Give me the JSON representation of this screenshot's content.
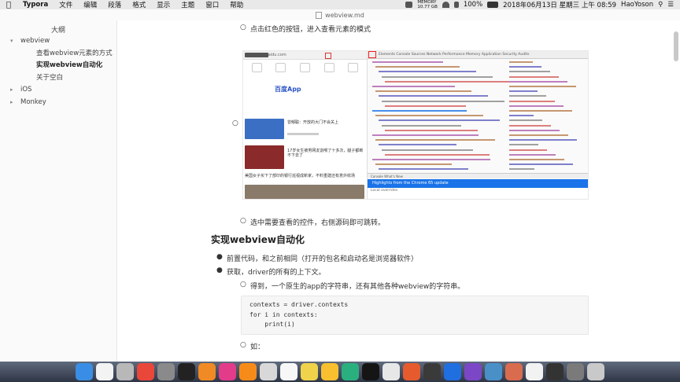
{
  "menubar": {
    "app": "Typora",
    "items": [
      "文件",
      "编辑",
      "段落",
      "格式",
      "显示",
      "主题",
      "窗口",
      "帮助"
    ],
    "network_up": "MEMORY",
    "network_down": "10.77 GB",
    "battery": "100%",
    "datetime": "2018年06月13日 星期三 上午 08:59",
    "user": "HaoYoson"
  },
  "window": {
    "title": "webview.md"
  },
  "sidebar": {
    "title": "大纲",
    "items": [
      {
        "label": "webview"
      },
      {
        "label": "查看webview元素的方式"
      },
      {
        "label": "实现webview自动化"
      },
      {
        "label": "关于空白"
      },
      {
        "label": "iOS"
      },
      {
        "label": "Monkey"
      }
    ]
  },
  "content": {
    "bullet_top": "点击红色的按钮，进入查看元素的模式",
    "bullet_select": "选中需要查看的控件，右侧源码即可跳转。",
    "heading": "实现webview自动化",
    "bullet_precode": "前置代码，和之前相同（打开的包名和启动名是浏览器软件）",
    "bullet_get": "获取，driver的所有的上下文。",
    "bullet_result": "得到，一个原生的app的字符串，还有其他各种webview的字符串。",
    "code_lines": [
      "contexts = driver.contexts",
      "for i in contexts:",
      "    print(i)"
    ],
    "bullet_eg": "如："
  },
  "screenshot": {
    "url": "m.baidu.com",
    "brand": "百度App",
    "news1": "曾郁聪：开放的大门不会关上",
    "news2": "17岁女生被男网友割喉了十多次，腿子都断不下去了",
    "news3": "美国女子买下了部印的银行巡视成新家，不料重建还有意外收场",
    "devtools_tabs": "Elements  Console  Sources  Network  Performance  Memory  Application  Security  Audits",
    "devtools_banner": "Highlights from the Chrome 65 update",
    "console_tabs": "Console  What's New",
    "footer_text": "Local overrides"
  },
  "dock": {
    "apps": [
      "finder-icon",
      "calendar-icon",
      "launchpad-icon",
      "chrome-icon",
      "system-preferences-icon",
      "terminal-icon",
      "books-icon",
      "typora-icon",
      "sublime-icon",
      "photo-icon",
      "textedit-icon",
      "notes-icon",
      "sketch-icon",
      "pycharm-icon",
      "goland-icon",
      "charles-icon",
      "postman-icon",
      "tumblr-icon",
      "sourcetree-icon",
      "vpn-icon",
      "box-icon",
      "araxis-icon",
      "oo-icon",
      "obs-icon",
      "folder-icon",
      "trash-icon"
    ],
    "colors": [
      "#3a8de4",
      "#f3f3f3",
      "#b8b8b8",
      "#e8473a",
      "#8a8a8a",
      "#222222",
      "#f08a24",
      "#e23b8a",
      "#f78b19",
      "#d8d8d8",
      "#f7f7f7",
      "#f0d34a",
      "#f8c02e",
      "#2ab07f",
      "#151515",
      "#e7e7e7",
      "#e55b2d",
      "#3a3a3a",
      "#1f6fe0",
      "#7b47c7",
      "#4a90c8",
      "#d96b4e",
      "#f2f2f2",
      "#333333",
      "#7a7a7a",
      "#c9c9c9"
    ]
  }
}
